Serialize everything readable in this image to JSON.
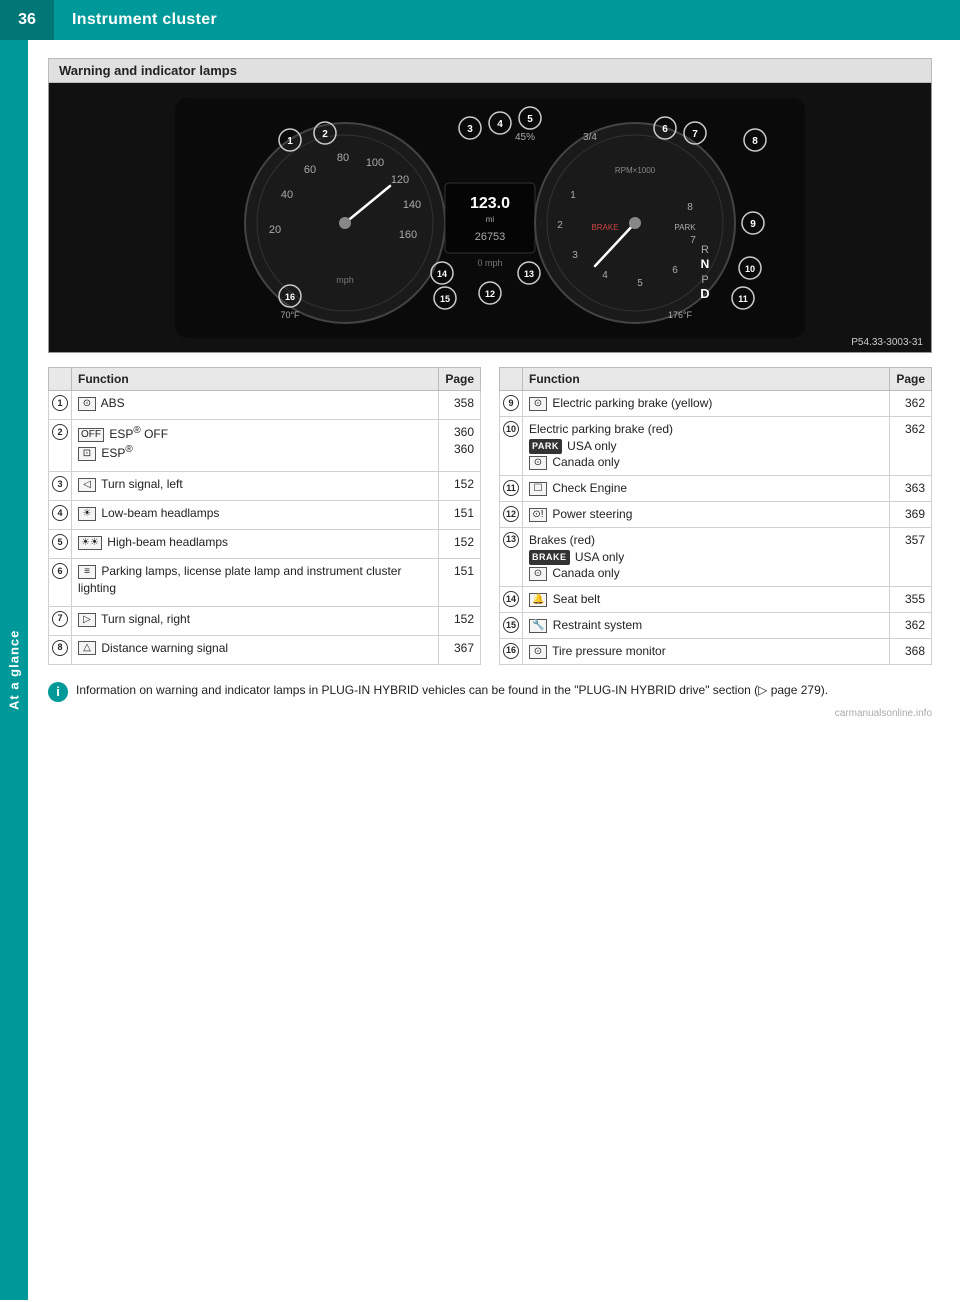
{
  "header": {
    "page_number": "36",
    "title": "Instrument cluster"
  },
  "side_tab": {
    "label": "At a glance"
  },
  "section": {
    "title": "Warning and indicator lamps"
  },
  "image_caption": "P54.33-3003-31",
  "table_left": {
    "col_function": "Function",
    "col_page": "Page",
    "rows": [
      {
        "num": "①",
        "icon": "⊙",
        "function": "ABS",
        "page": "358"
      },
      {
        "num": "②",
        "icon1": "ESP® OFF",
        "icon1_box": "OFF",
        "icon2_box": "",
        "function1": "ESP® OFF",
        "function2": "ESP®",
        "page1": "360",
        "page2": "360"
      },
      {
        "num": "③",
        "icon": "◁",
        "function": "Turn signal, left",
        "page": "152"
      },
      {
        "num": "④",
        "icon": "▷",
        "function": "Low-beam headlamps",
        "page": "151"
      },
      {
        "num": "⑤",
        "icon": "▷",
        "function": "High-beam headlamps",
        "page": "152"
      },
      {
        "num": "⑥",
        "icon": "≡",
        "function": "Parking lamps, license plate lamp and instrument cluster lighting",
        "page": "151"
      },
      {
        "num": "⑦",
        "icon": "▷",
        "function": "Turn signal, right",
        "page": "152"
      },
      {
        "num": "⑧",
        "icon": "△",
        "function": "Distance warning signal",
        "page": "367"
      }
    ]
  },
  "table_right": {
    "col_function": "Function",
    "col_page": "Page",
    "rows": [
      {
        "num": "⑨",
        "icon": "⊙",
        "function": "Electric parking brake (yellow)",
        "page": "362"
      },
      {
        "num": "⑩",
        "function": "Electric parking brake (red)",
        "sub1_badge": "PARK",
        "sub1_text": "USA only",
        "sub2_icon": "⊙",
        "sub2_text": "Canada only",
        "page": "362"
      },
      {
        "num": "⑪",
        "icon": "☐",
        "function": "Check Engine",
        "page": "363"
      },
      {
        "num": "⑫",
        "icon": "⊙",
        "function": "Power steering",
        "page": "369"
      },
      {
        "num": "⑬",
        "function": "Brakes (red)",
        "sub1_badge": "BRAKE",
        "sub1_text": "USA only",
        "sub2_icon": "⊙",
        "sub2_text": "Canada only",
        "page": "357"
      },
      {
        "num": "⑭",
        "icon": "🔔",
        "function": "Seat belt",
        "page": "355"
      },
      {
        "num": "⑮",
        "icon": "🔧",
        "function": "Restraint system",
        "page": "362"
      },
      {
        "num": "⑯",
        "icon": "⊙",
        "function": "Tire pressure monitor",
        "page": "368"
      }
    ]
  },
  "info_note": {
    "text": "Information on warning and indicator lamps in PLUG-IN HYBRID vehicles can be found in the \"PLUG-IN HYBRID drive\" section (▷ page 279)."
  }
}
